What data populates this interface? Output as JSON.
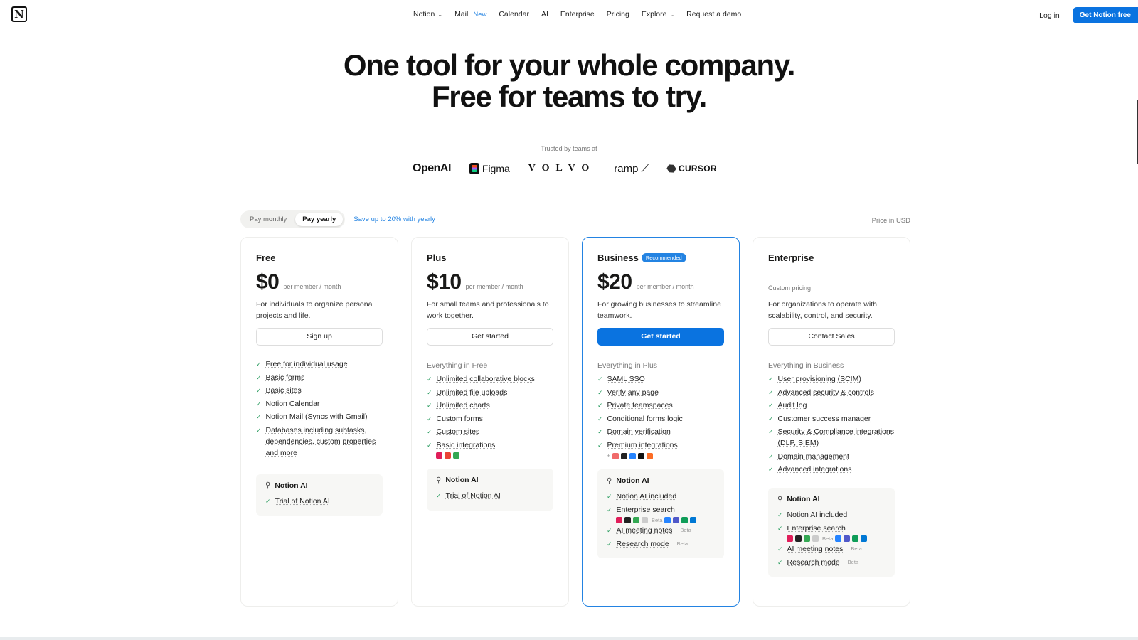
{
  "nav": {
    "logo": "N",
    "links": [
      {
        "label": "Notion",
        "dropdown": true
      },
      {
        "label": "Mail",
        "badge": "New"
      },
      {
        "label": "Calendar"
      },
      {
        "label": "AI"
      },
      {
        "label": "Enterprise"
      },
      {
        "label": "Pricing"
      },
      {
        "label": "Explore",
        "dropdown": true
      },
      {
        "label": "Request a demo"
      }
    ],
    "login": "Log in",
    "cta": "Get Notion free"
  },
  "hero": {
    "line1": "One tool for your whole company.",
    "line2": "Free for teams to try."
  },
  "trusted": {
    "label": "Trusted by teams at",
    "brands": [
      "OpenAI",
      "Figma",
      "VOLVO",
      "ramp",
      "CURSOR"
    ]
  },
  "billing": {
    "monthly": "Pay monthly",
    "yearly": "Pay yearly",
    "selected": "Pay yearly",
    "save": "Save up to 20% with yearly",
    "currency": "Price in USD"
  },
  "plans": [
    {
      "name": "Free",
      "price": "$0",
      "per": "per member / month",
      "desc": "For individuals to organize personal projects and life.",
      "button": "Sign up",
      "features_heading": "",
      "features": [
        "Free for individual usage",
        "Basic forms",
        "Basic sites",
        "Notion Calendar",
        "Notion Mail (Syncs with Gmail)",
        "Databases including subtasks, dependencies, custom properties and more"
      ],
      "ai": {
        "title": "Notion AI",
        "items": [
          "Trial of Notion AI"
        ]
      }
    },
    {
      "name": "Plus",
      "price": "$10",
      "per": "per member / month",
      "desc": "For small teams and professionals to work together.",
      "button": "Get started",
      "features_heading": "Everything in Free",
      "features": [
        "Unlimited collaborative blocks",
        "Unlimited file uploads",
        "Unlimited charts",
        "Custom forms",
        "Custom sites",
        "Basic integrations"
      ],
      "ai": {
        "title": "Notion AI",
        "items": [
          "Trial of Notion AI"
        ]
      }
    },
    {
      "name": "Business",
      "badge": "Recommended",
      "price": "$20",
      "per": "per member / month",
      "desc": "For growing businesses to streamline teamwork.",
      "button": "Get started",
      "features_heading": "Everything in Plus",
      "features": [
        "SAML SSO",
        "Verify any page",
        "Private teamspaces",
        "Conditional forms logic",
        "Domain verification",
        "Premium integrations"
      ],
      "ai": {
        "title": "Notion AI",
        "items": [
          "Notion AI included",
          "Enterprise search",
          "AI meeting notes",
          "Research mode"
        ],
        "beta": "Beta"
      }
    },
    {
      "name": "Enterprise",
      "custom": "Custom pricing",
      "desc": "For organizations to operate with scalability, control, and security.",
      "button": "Contact Sales",
      "features_heading": "Everything in Business",
      "features": [
        "User provisioning (SCIM)",
        "Advanced security & controls",
        "Audit log",
        "Customer success manager",
        "Security & Compliance integrations (DLP, SIEM)",
        "Domain management",
        "Advanced integrations"
      ],
      "ai": {
        "title": "Notion AI",
        "items": [
          "Notion AI included",
          "Enterprise search",
          "AI meeting notes",
          "Research mode"
        ],
        "beta": "Beta"
      }
    }
  ],
  "colors": {
    "accent": "#0a73e0",
    "check": "#2e9e63"
  }
}
